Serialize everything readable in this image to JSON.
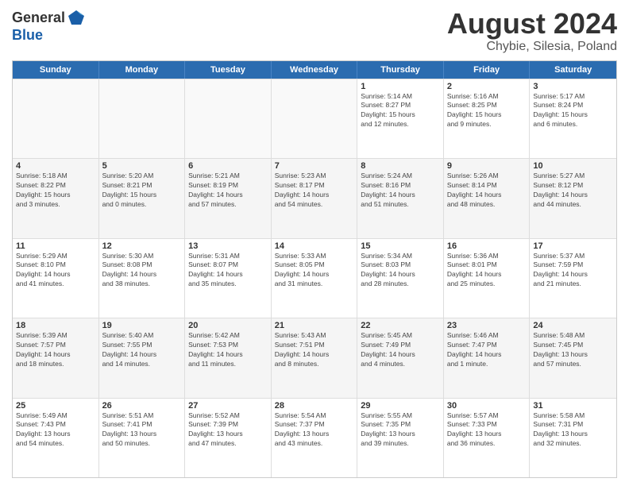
{
  "header": {
    "logo_general": "General",
    "logo_blue": "Blue",
    "main_title": "August 2024",
    "subtitle": "Chybie, Silesia, Poland"
  },
  "calendar": {
    "days_of_week": [
      "Sunday",
      "Monday",
      "Tuesday",
      "Wednesday",
      "Thursday",
      "Friday",
      "Saturday"
    ],
    "weeks": [
      [
        {
          "day": "",
          "info": "",
          "empty": true
        },
        {
          "day": "",
          "info": "",
          "empty": true
        },
        {
          "day": "",
          "info": "",
          "empty": true
        },
        {
          "day": "",
          "info": "",
          "empty": true
        },
        {
          "day": "1",
          "info": "Sunrise: 5:14 AM\nSunset: 8:27 PM\nDaylight: 15 hours\nand 12 minutes.",
          "empty": false
        },
        {
          "day": "2",
          "info": "Sunrise: 5:16 AM\nSunset: 8:25 PM\nDaylight: 15 hours\nand 9 minutes.",
          "empty": false
        },
        {
          "day": "3",
          "info": "Sunrise: 5:17 AM\nSunset: 8:24 PM\nDaylight: 15 hours\nand 6 minutes.",
          "empty": false
        }
      ],
      [
        {
          "day": "4",
          "info": "Sunrise: 5:18 AM\nSunset: 8:22 PM\nDaylight: 15 hours\nand 3 minutes.",
          "empty": false
        },
        {
          "day": "5",
          "info": "Sunrise: 5:20 AM\nSunset: 8:21 PM\nDaylight: 15 hours\nand 0 minutes.",
          "empty": false
        },
        {
          "day": "6",
          "info": "Sunrise: 5:21 AM\nSunset: 8:19 PM\nDaylight: 14 hours\nand 57 minutes.",
          "empty": false
        },
        {
          "day": "7",
          "info": "Sunrise: 5:23 AM\nSunset: 8:17 PM\nDaylight: 14 hours\nand 54 minutes.",
          "empty": false
        },
        {
          "day": "8",
          "info": "Sunrise: 5:24 AM\nSunset: 8:16 PM\nDaylight: 14 hours\nand 51 minutes.",
          "empty": false
        },
        {
          "day": "9",
          "info": "Sunrise: 5:26 AM\nSunset: 8:14 PM\nDaylight: 14 hours\nand 48 minutes.",
          "empty": false
        },
        {
          "day": "10",
          "info": "Sunrise: 5:27 AM\nSunset: 8:12 PM\nDaylight: 14 hours\nand 44 minutes.",
          "empty": false
        }
      ],
      [
        {
          "day": "11",
          "info": "Sunrise: 5:29 AM\nSunset: 8:10 PM\nDaylight: 14 hours\nand 41 minutes.",
          "empty": false
        },
        {
          "day": "12",
          "info": "Sunrise: 5:30 AM\nSunset: 8:08 PM\nDaylight: 14 hours\nand 38 minutes.",
          "empty": false
        },
        {
          "day": "13",
          "info": "Sunrise: 5:31 AM\nSunset: 8:07 PM\nDaylight: 14 hours\nand 35 minutes.",
          "empty": false
        },
        {
          "day": "14",
          "info": "Sunrise: 5:33 AM\nSunset: 8:05 PM\nDaylight: 14 hours\nand 31 minutes.",
          "empty": false
        },
        {
          "day": "15",
          "info": "Sunrise: 5:34 AM\nSunset: 8:03 PM\nDaylight: 14 hours\nand 28 minutes.",
          "empty": false
        },
        {
          "day": "16",
          "info": "Sunrise: 5:36 AM\nSunset: 8:01 PM\nDaylight: 14 hours\nand 25 minutes.",
          "empty": false
        },
        {
          "day": "17",
          "info": "Sunrise: 5:37 AM\nSunset: 7:59 PM\nDaylight: 14 hours\nand 21 minutes.",
          "empty": false
        }
      ],
      [
        {
          "day": "18",
          "info": "Sunrise: 5:39 AM\nSunset: 7:57 PM\nDaylight: 14 hours\nand 18 minutes.",
          "empty": false
        },
        {
          "day": "19",
          "info": "Sunrise: 5:40 AM\nSunset: 7:55 PM\nDaylight: 14 hours\nand 14 minutes.",
          "empty": false
        },
        {
          "day": "20",
          "info": "Sunrise: 5:42 AM\nSunset: 7:53 PM\nDaylight: 14 hours\nand 11 minutes.",
          "empty": false
        },
        {
          "day": "21",
          "info": "Sunrise: 5:43 AM\nSunset: 7:51 PM\nDaylight: 14 hours\nand 8 minutes.",
          "empty": false
        },
        {
          "day": "22",
          "info": "Sunrise: 5:45 AM\nSunset: 7:49 PM\nDaylight: 14 hours\nand 4 minutes.",
          "empty": false
        },
        {
          "day": "23",
          "info": "Sunrise: 5:46 AM\nSunset: 7:47 PM\nDaylight: 14 hours\nand 1 minute.",
          "empty": false
        },
        {
          "day": "24",
          "info": "Sunrise: 5:48 AM\nSunset: 7:45 PM\nDaylight: 13 hours\nand 57 minutes.",
          "empty": false
        }
      ],
      [
        {
          "day": "25",
          "info": "Sunrise: 5:49 AM\nSunset: 7:43 PM\nDaylight: 13 hours\nand 54 minutes.",
          "empty": false
        },
        {
          "day": "26",
          "info": "Sunrise: 5:51 AM\nSunset: 7:41 PM\nDaylight: 13 hours\nand 50 minutes.",
          "empty": false
        },
        {
          "day": "27",
          "info": "Sunrise: 5:52 AM\nSunset: 7:39 PM\nDaylight: 13 hours\nand 47 minutes.",
          "empty": false
        },
        {
          "day": "28",
          "info": "Sunrise: 5:54 AM\nSunset: 7:37 PM\nDaylight: 13 hours\nand 43 minutes.",
          "empty": false
        },
        {
          "day": "29",
          "info": "Sunrise: 5:55 AM\nSunset: 7:35 PM\nDaylight: 13 hours\nand 39 minutes.",
          "empty": false
        },
        {
          "day": "30",
          "info": "Sunrise: 5:57 AM\nSunset: 7:33 PM\nDaylight: 13 hours\nand 36 minutes.",
          "empty": false
        },
        {
          "day": "31",
          "info": "Sunrise: 5:58 AM\nSunset: 7:31 PM\nDaylight: 13 hours\nand 32 minutes.",
          "empty": false
        }
      ]
    ]
  }
}
